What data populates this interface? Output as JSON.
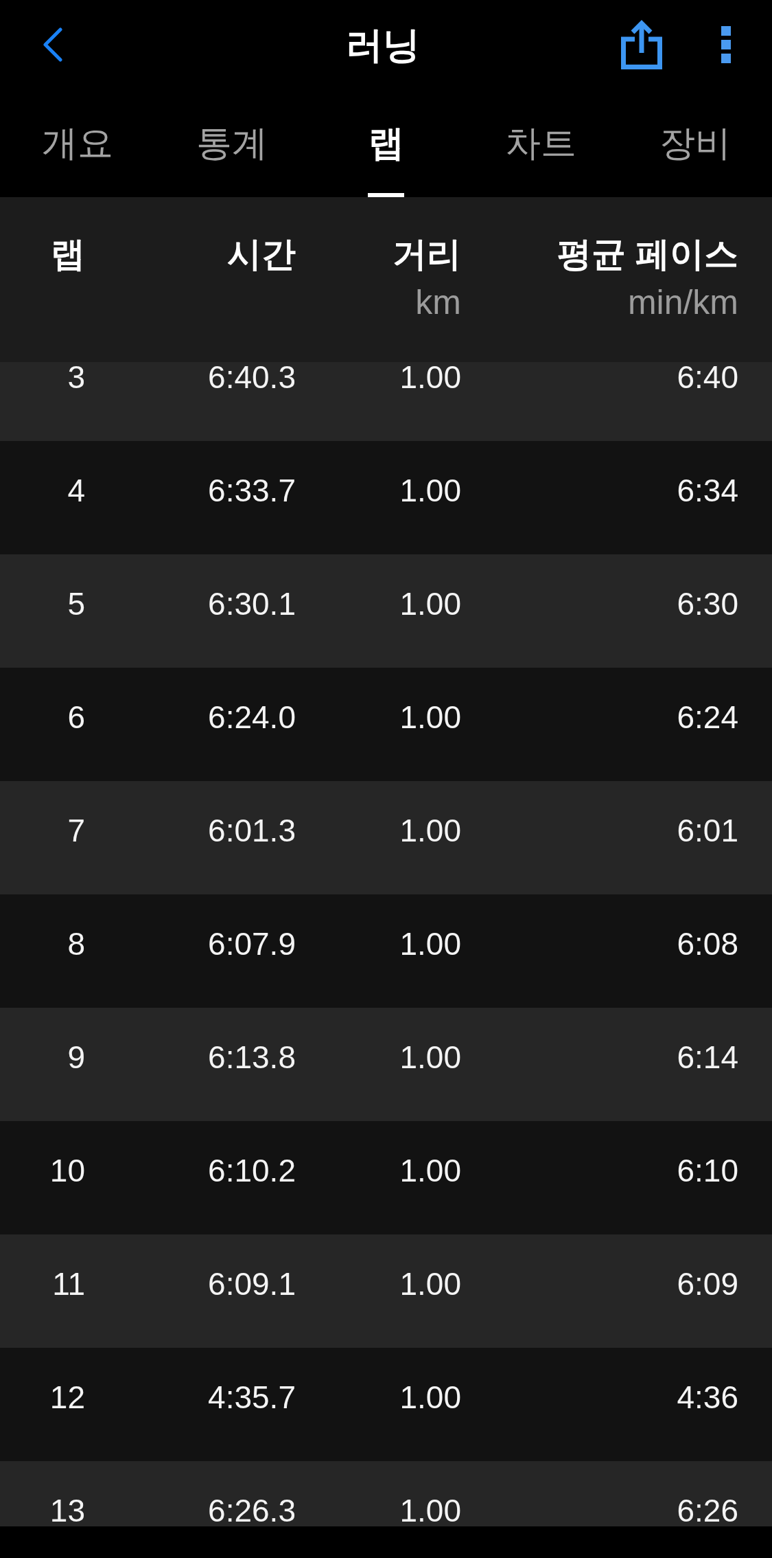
{
  "top_bar": {
    "title": "러닝"
  },
  "tabs": [
    {
      "label": "개요",
      "selected": false
    },
    {
      "label": "통계",
      "selected": false
    },
    {
      "label": "랩",
      "selected": true
    },
    {
      "label": "차트",
      "selected": false
    },
    {
      "label": "장비",
      "selected": false
    }
  ],
  "table": {
    "columns": [
      {
        "label": "랩"
      },
      {
        "label": "시간"
      },
      {
        "label": "거리",
        "unit": "km"
      },
      {
        "label": "평균 페이스",
        "unit": "min/km"
      }
    ],
    "rows": [
      {
        "cells": [
          "3",
          "6:40.3",
          "1.00",
          "6:40"
        ]
      },
      {
        "cells": [
          "4",
          "6:33.7",
          "1.00",
          "6:34"
        ]
      },
      {
        "cells": [
          "5",
          "6:30.1",
          "1.00",
          "6:30"
        ]
      },
      {
        "cells": [
          "6",
          "6:24.0",
          "1.00",
          "6:24"
        ]
      },
      {
        "cells": [
          "7",
          "6:01.3",
          "1.00",
          "6:01"
        ]
      },
      {
        "cells": [
          "8",
          "6:07.9",
          "1.00",
          "6:08"
        ]
      },
      {
        "cells": [
          "9",
          "6:13.8",
          "1.00",
          "6:14"
        ]
      },
      {
        "cells": [
          "10",
          "6:10.2",
          "1.00",
          "6:10"
        ]
      },
      {
        "cells": [
          "11",
          "6:09.1",
          "1.00",
          "6:09"
        ]
      },
      {
        "cells": [
          "12",
          "4:35.7",
          "1.00",
          "4:36"
        ]
      },
      {
        "cells": [
          "13",
          "6:26.3",
          "1.00",
          "6:26"
        ]
      }
    ]
  }
}
